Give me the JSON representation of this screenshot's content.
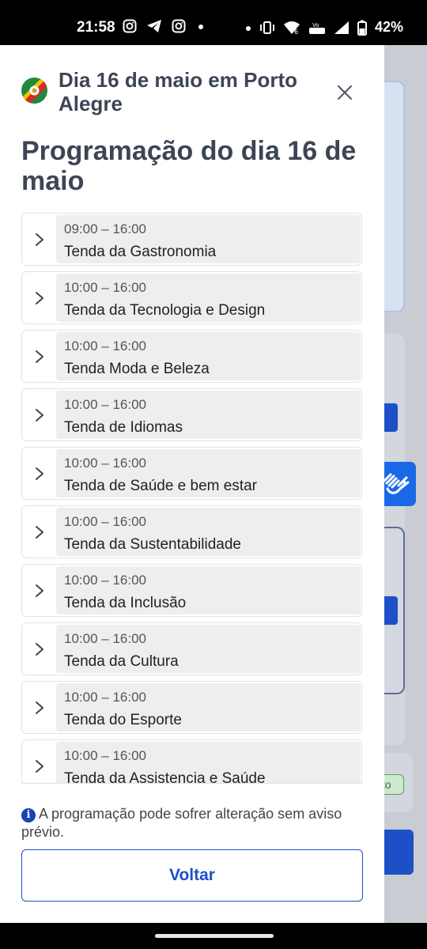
{
  "status_bar": {
    "time": "21:58",
    "left_icons": [
      "instagram-icon",
      "telegram-icon",
      "instagram-icon",
      "dot-icon"
    ],
    "right_icons": [
      "dot-icon",
      "vibrate-icon",
      "wifi-icon",
      "volte-icon",
      "signal-icon",
      "battery-icon"
    ],
    "battery": "42%"
  },
  "dialog": {
    "title": "Dia 16 de maio em Porto Alegre",
    "section_title": "Programação do dia 16 de maio",
    "schedule": [
      {
        "time": "09:00 – 16:00",
        "name": "Tenda da Gastronomia"
      },
      {
        "time": "10:00 – 16:00",
        "name": "Tenda da Tecnologia e Design"
      },
      {
        "time": "10:00 – 16:00",
        "name": "Tenda Moda e Beleza"
      },
      {
        "time": "10:00 – 16:00",
        "name": "Tenda de Idiomas"
      },
      {
        "time": "10:00 – 16:00",
        "name": "Tenda de Saúde e bem estar"
      },
      {
        "time": "10:00 – 16:00",
        "name": "Tenda da Sustentabilidade"
      },
      {
        "time": "10:00 – 16:00",
        "name": "Tenda da Inclusão"
      },
      {
        "time": "10:00 – 16:00",
        "name": "Tenda da Cultura"
      },
      {
        "time": "10:00 – 16:00",
        "name": "Tenda do Esporte"
      },
      {
        "time": "10:00 – 16:00",
        "name": "Tenda da Assistencia e Saúde"
      }
    ],
    "notice": "A programação pode sofrer alteração sem aviso prévio.",
    "back_label": "Voltar"
  },
  "background": {
    "badge_text": "to"
  },
  "colors": {
    "primary": "#1d4fc7",
    "title_text": "#3d4555",
    "item_bg": "#eeeeee",
    "a11y_button": "#1a6ae8"
  }
}
